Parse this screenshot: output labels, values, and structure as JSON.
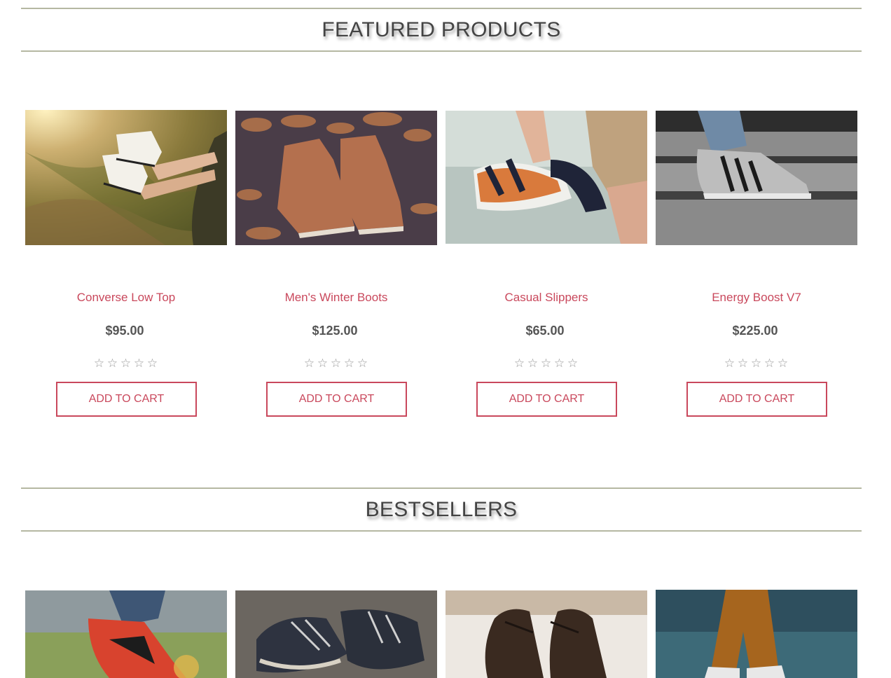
{
  "featured": {
    "title": "FEATURED PRODUCTS",
    "products": [
      {
        "name": "Converse Low Top",
        "price": "$95.00",
        "button": "ADD TO CART",
        "rating": 0,
        "image": "sneakers-legs-photo"
      },
      {
        "name": "Men's Winter Boots",
        "price": "$125.00",
        "button": "ADD TO CART",
        "rating": 0,
        "image": "brown-boots-leaves-photo"
      },
      {
        "name": "Casual Slippers",
        "price": "$65.00",
        "button": "ADD TO CART",
        "rating": 0,
        "image": "hand-holding-sandals-photo"
      },
      {
        "name": "Energy Boost V7",
        "price": "$225.00",
        "button": "ADD TO CART",
        "rating": 0,
        "image": "sneaker-on-stairs-photo"
      }
    ]
  },
  "bestsellers": {
    "title": "BESTSELLERS",
    "products": [
      {
        "image": "red-sneaker-photo"
      },
      {
        "image": "worn-sneakers-photo"
      },
      {
        "image": "dress-shoes-photo"
      },
      {
        "image": "brown-pants-shoes-photo"
      }
    ]
  },
  "rating_star": "☆",
  "colors": {
    "accent": "#c9485c",
    "divider": "#b5b8a2",
    "price": "#555555"
  }
}
